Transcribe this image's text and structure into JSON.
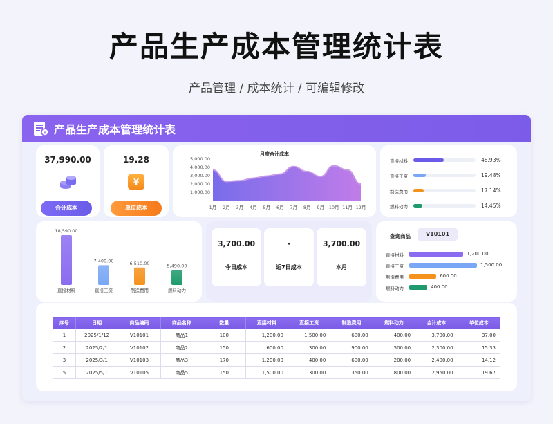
{
  "page": {
    "title": "产品生产成本管理统计表",
    "subtitle": "产品管理 / 成本统计 / 可编辑修改"
  },
  "panel": {
    "title": "产品生产成本管理统计表"
  },
  "kpis": [
    {
      "value": "37,990.00",
      "label": "合计成本",
      "icon": "coins-icon"
    },
    {
      "value": "19.28",
      "label": "单位成本",
      "icon": "yen-icon",
      "icon_text": "¥"
    }
  ],
  "monthly_chart": {
    "title": "月度合计成本",
    "y_ticks": [
      "5,000.00",
      "4,000.00",
      "3,000.00",
      "2,000.00",
      "1,000.00",
      "-"
    ],
    "x_labels": [
      "1月",
      "2月",
      "3月",
      "4月",
      "5月",
      "6月",
      "7月",
      "8月",
      "9月",
      "10月",
      "11月",
      "12月"
    ]
  },
  "shares": [
    {
      "label": "直接材料",
      "pct": "48.93%",
      "value": 0.4893,
      "color": "#6a5ce8"
    },
    {
      "label": "直接工资",
      "pct": "19.48%",
      "value": 0.1948,
      "color": "#7aa7f5"
    },
    {
      "label": "制造费用",
      "pct": "17.14%",
      "value": 0.1714,
      "color": "#f5921e"
    },
    {
      "label": "燃料动力",
      "pct": "14.45%",
      "value": 0.1445,
      "color": "#1f9a6c"
    }
  ],
  "cost_bars": [
    {
      "label": "直接材料",
      "value_text": "18,590.00",
      "value": 18590,
      "color": "#8b6cf0"
    },
    {
      "label": "直接工资",
      "value_text": "7,400.00",
      "value": 7400,
      "color": "#7aa7f5"
    },
    {
      "label": "制造费用",
      "value_text": "6,510.00",
      "value": 6510,
      "color": "#f5921e"
    },
    {
      "label": "燃料动力",
      "value_text": "5,490.00",
      "value": 5490,
      "color": "#1f9a6c"
    }
  ],
  "period_cards": [
    {
      "value": "3,700.00",
      "label": "今日成本"
    },
    {
      "value": "-",
      "label": "近7日成本"
    },
    {
      "value": "3,700.00",
      "label": "本月"
    }
  ],
  "query": {
    "label": "查询商品",
    "product": "V10101",
    "rows": [
      {
        "label": "直接材料",
        "value_text": "1,200.00",
        "value": 1200,
        "color": "#8b6cf0"
      },
      {
        "label": "直接工资",
        "value_text": "1,500.00",
        "value": 1500,
        "color": "#7aa7f5"
      },
      {
        "label": "制造费用",
        "value_text": "600.00",
        "value": 600,
        "color": "#f5921e"
      },
      {
        "label": "燃料动力",
        "value_text": "400.00",
        "value": 400,
        "color": "#1f9a6c"
      }
    ]
  },
  "table": {
    "headers": [
      "序号",
      "日期",
      "商品编码",
      "商品名称",
      "数量",
      "直接材料",
      "直接工资",
      "制造费用",
      "燃料动力",
      "合计成本",
      "单位成本"
    ],
    "rows": [
      [
        "1",
        "2025/1/12",
        "V10101",
        "商品1",
        "100",
        "1,200.00",
        "1,500.00",
        "600.00",
        "400.00",
        "3,700.00",
        "37.00"
      ],
      [
        "2",
        "2025/2/1",
        "V10102",
        "商品2",
        "150",
        "600.00",
        "300.00",
        "900.00",
        "500.00",
        "2,300.00",
        "15.33"
      ],
      [
        "3",
        "2025/3/1",
        "V10103",
        "商品3",
        "170",
        "1,200.00",
        "400.00",
        "600.00",
        "200.00",
        "2,400.00",
        "14.12"
      ],
      [
        "5",
        "2025/5/1",
        "V10105",
        "商品5",
        "150",
        "1,500.00",
        "300.00",
        "350.00",
        "800.00",
        "2,950.00",
        "19.67"
      ]
    ]
  },
  "chart_data": {
    "type": "area",
    "title": "月度合计成本",
    "x": [
      "1月",
      "2月",
      "3月",
      "4月",
      "5月",
      "6月",
      "7月",
      "8月",
      "9月",
      "10月",
      "11月",
      "12月"
    ],
    "series": [
      {
        "values": [
          3700,
          2300,
          2400,
          2700,
          2950,
          3200,
          4100,
          3500,
          2900,
          4200,
          3700,
          2000
        ]
      }
    ],
    "ylim": [
      0,
      5000
    ],
    "colors": [
      "#6a5ce8",
      "#b96ee6"
    ]
  }
}
